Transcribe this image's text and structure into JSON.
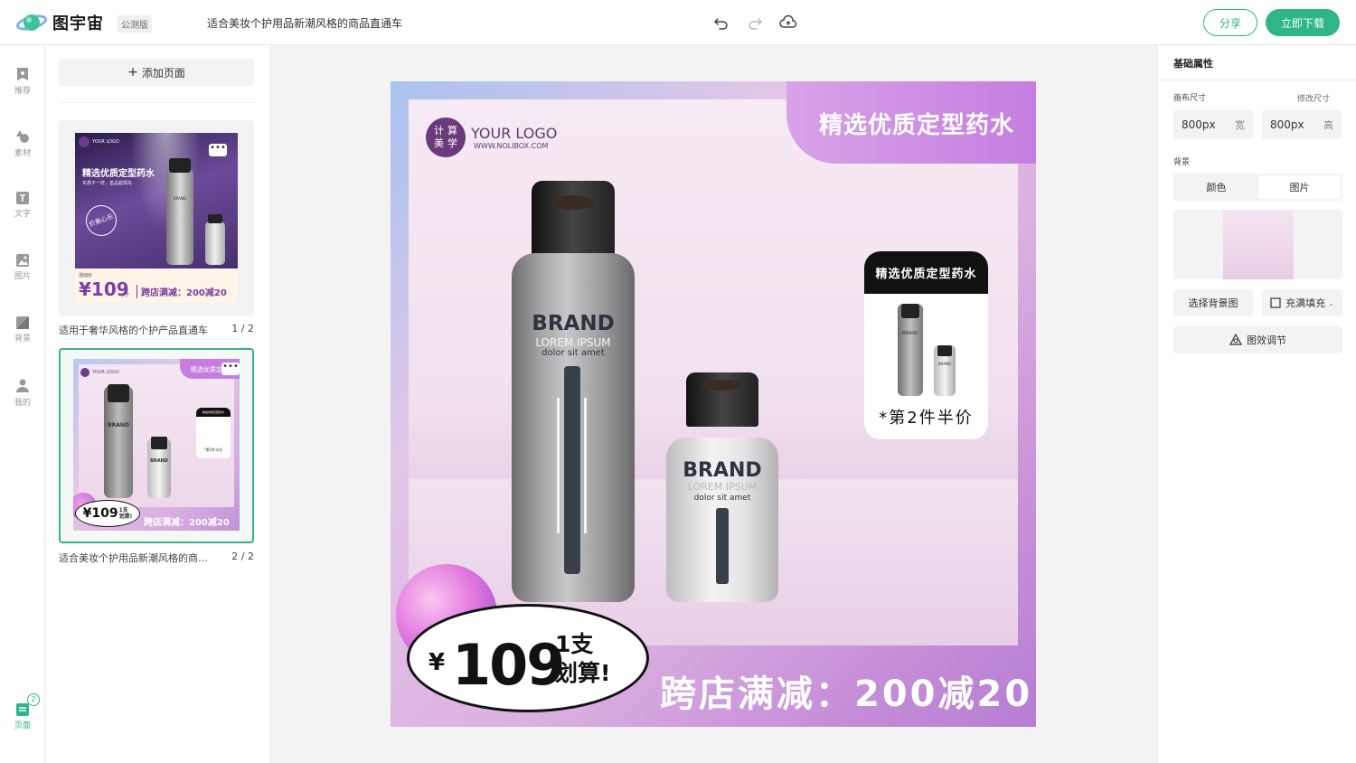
{
  "header": {
    "app_name": "图宇宙",
    "beta_badge": "公测版",
    "doc_title": "适合美妆个护用品新潮风格的商品直通车",
    "share_label": "分享",
    "download_label": "立即下载",
    "icons": [
      "undo-icon",
      "redo-icon",
      "cloud-upload-icon"
    ]
  },
  "leftnav": {
    "items": [
      {
        "label": "推荐",
        "icon": "recommend-icon"
      },
      {
        "label": "素材",
        "icon": "shapes-icon"
      },
      {
        "label": "文字",
        "icon": "text-icon"
      },
      {
        "label": "图片",
        "icon": "image-icon"
      },
      {
        "label": "背景",
        "icon": "background-icon"
      },
      {
        "label": "我的",
        "icon": "user-icon"
      }
    ],
    "pages_label": "页面",
    "pages_count": "2"
  },
  "pages": {
    "add_label": "添加页面",
    "list": [
      {
        "name": "适用于奢华风格的个护产品直通车",
        "index": "1 / 2",
        "thumb": {
          "logo": "YOUR LOGO",
          "headline": "精选优质定型药水",
          "sub": "实惠不一样，善品超领先",
          "badge": "价美心乐",
          "brand": "BRAND",
          "price_tag": "活动价",
          "price": "¥109",
          "unit": "/件",
          "promo": "跨店满减：200减20"
        }
      },
      {
        "name": "适合美妆个护用品新潮风格的商…",
        "index": "2 / 2",
        "thumb": {
          "logo": "YOUR LOGO",
          "headline": "精选优质定型",
          "card_title": "精选优质定型药水",
          "card_sub": "*第2件半价",
          "brand": "BRAND",
          "price": "¥109",
          "price_note1": "1支",
          "price_note2": "划算!",
          "promo": "跨店满减：200减20"
        }
      }
    ],
    "more_label": "•••"
  },
  "canvas": {
    "logo_chars": [
      "计",
      "算",
      "美",
      "学"
    ],
    "logo_text": "YOUR LOGO",
    "logo_url": "WWW.NOLIBOX.COM",
    "headline": "精选优质定型药水",
    "big_bottle": {
      "brand": "BRAND",
      "line1": "LOREM IPSUM",
      "line2": "dolor sit amet"
    },
    "small_bottle": {
      "brand": "BRAND",
      "line1": "LOREM IPSUM",
      "line2": "dolor sit amet"
    },
    "card": {
      "title": "精选优质定型药水",
      "text": "*第2件半价",
      "mini_brand": "BRAND"
    },
    "price": {
      "currency": "¥",
      "amount": "109",
      "note1": "1支",
      "note2": "划算!"
    },
    "promo": "跨店满减：200减20"
  },
  "properties": {
    "title": "基础属性",
    "canvas_size_label": "画布尺寸",
    "edit_size_label": "修改尺寸",
    "width_value": "800px",
    "width_unit": "宽",
    "height_value": "800px",
    "height_unit": "高",
    "background_label": "背景",
    "tab_color": "颜色",
    "tab_image": "图片",
    "select_bg_label": "选择背景图",
    "fill_mode_label": "充满填充",
    "effects_label": "图效调节"
  },
  "colors": {
    "accent": "#2fb58a",
    "purple": "#c57ee0",
    "dark": "#222222"
  }
}
